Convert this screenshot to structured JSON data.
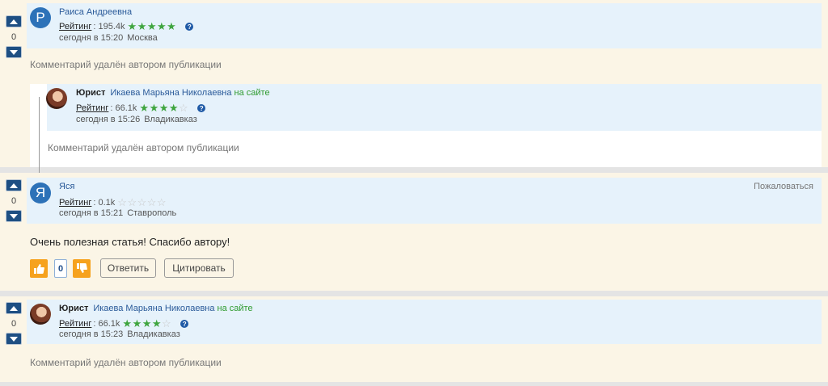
{
  "common": {
    "rating_label": "Рейтинг",
    "deleted_text": "Комментарий удалён автором публикации",
    "help_glyph": "?"
  },
  "comments": [
    {
      "votes": "0",
      "avatar_letter": "Р",
      "author": "Раиса Андреевна",
      "rating_value": ": 195.4k",
      "stars_filled": 5,
      "time": "сегодня в 15:20",
      "city": "Москва"
    },
    {
      "role": "Юрист",
      "author": "Икаева Марьяна Николаевна",
      "online": "на сайте",
      "rating_value": ": 66.1k",
      "stars_filled": 4,
      "time": "сегодня в 15:26",
      "city": "Владикавказ"
    },
    {
      "votes": "0",
      "avatar_letter": "Я",
      "author": "Яся",
      "rating_value": ": 0.1k",
      "stars_filled": 0,
      "time": "сегодня в 15:21",
      "city": "Ставрополь",
      "complain": "Пожаловаться",
      "text": "Очень полезная статья! Спасибо автору!",
      "like_count": "0",
      "reply_label": "Ответить",
      "quote_label": "Цитировать"
    },
    {
      "votes": "0",
      "role": "Юрист",
      "author": "Икаева Марьяна Николаевна",
      "online": "на сайте",
      "rating_value": ": 66.1k",
      "stars_filled": 4,
      "time": "сегодня в 15:23",
      "city": "Владикавказ"
    }
  ],
  "colors": {
    "background": "#fbf5e6",
    "header": "#e6f2fb",
    "link": "#2a5a99",
    "online": "#2e9a2e",
    "star": "#3fa53f",
    "like": "#f6a21e",
    "vote_button": "#1e4f83"
  },
  "icons": [
    "arrow-up-icon",
    "arrow-down-icon",
    "star-icon",
    "help-icon",
    "thumbs-up-icon",
    "thumbs-down-icon"
  ]
}
